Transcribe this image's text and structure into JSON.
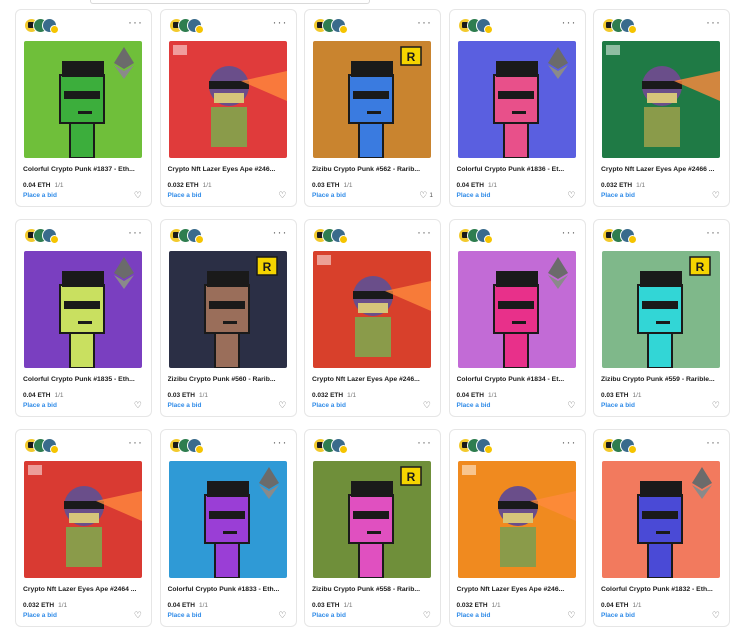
{
  "cards": [
    {
      "title": "Colorful Crypto Punk #1837 - Eth...",
      "price": "0.04 ETH",
      "edition": "1/1",
      "bid_label": "Place a bid",
      "likes": "",
      "art": "punk-green-afro",
      "bg": "#6fbf3a"
    },
    {
      "title": "Crypto Nft Lazer Eyes Ape #246...",
      "price": "0.032 ETH",
      "edition": "1/1",
      "bid_label": "Place a bid",
      "likes": "",
      "art": "ape-pizza",
      "bg": "#e03b3b"
    },
    {
      "title": "Zizibu Crypto Punk #562 - Rarib...",
      "price": "0.03 ETH",
      "edition": "1/1",
      "bid_label": "Place a bid",
      "likes": "1",
      "art": "punk-blue-beanie",
      "bg": "#c9842f"
    },
    {
      "title": "Colorful Crypto Punk #1836 - Et...",
      "price": "0.04 ETH",
      "edition": "1/1",
      "bid_label": "Place a bid",
      "likes": "",
      "art": "punk-pink-hair",
      "bg": "#5a5fe0"
    },
    {
      "title": "Crypto Nft Lazer Eyes Ape #2466 ...",
      "price": "0.032 ETH",
      "edition": "1/1",
      "bid_label": "Place a bid",
      "likes": "",
      "art": "ape-starbucks",
      "bg": "#1f7a45"
    },
    {
      "title": "Colorful Crypto Punk #1835 - Eth...",
      "price": "0.04 ETH",
      "edition": "1/1",
      "bid_label": "Place a bid",
      "likes": "",
      "art": "punk-lime-hat",
      "bg": "#7a3fc0"
    },
    {
      "title": "Zizibu Crypto Punk #560 - Rarib...",
      "price": "0.03 ETH",
      "edition": "1/1",
      "bid_label": "Place a bid",
      "likes": "",
      "art": "punk-brown",
      "bg": "#2b2f45"
    },
    {
      "title": "Crypto Nft Lazer Eyes Ape #246...",
      "price": "0.032 ETH",
      "edition": "1/1",
      "bid_label": "Place a bid",
      "likes": "",
      "art": "ape-mcdonalds",
      "bg": "#d8402b"
    },
    {
      "title": "Colorful Crypto Punk #1834 - Et...",
      "price": "0.04 ETH",
      "edition": "1/1",
      "bid_label": "Place a bid",
      "likes": "",
      "art": "punk-pink-green",
      "bg": "#c26bd6"
    },
    {
      "title": "Zizibu Crypto Punk #559 - Rarible...",
      "price": "0.03 ETH",
      "edition": "1/1",
      "bid_label": "Place a bid",
      "likes": "",
      "art": "punk-cyan",
      "bg": "#7fb88a"
    },
    {
      "title": "Crypto Nft Lazer Eyes Ape #2464 ...",
      "price": "0.032 ETH",
      "edition": "1/1",
      "bid_label": "Place a bid",
      "likes": "",
      "art": "ape-cocacola",
      "bg": "#d93a32"
    },
    {
      "title": "Colorful Crypto Punk #1833 - Eth...",
      "price": "0.04 ETH",
      "edition": "1/1",
      "bid_label": "Place a bid",
      "likes": "",
      "art": "punk-purple-tophat",
      "bg": "#2f9ad6"
    },
    {
      "title": "Zizibu Crypto Punk #558 - Rarib...",
      "price": "0.03 ETH",
      "edition": "1/1",
      "bid_label": "Place a bid",
      "likes": "",
      "art": "punk-pink-greenhat",
      "bg": "#6f8f3a"
    },
    {
      "title": "Crypto Nft Lazer Eyes Ape #246...",
      "price": "0.032 ETH",
      "edition": "1/1",
      "bid_label": "Place a bid",
      "likes": "",
      "art": "ape-burgerking",
      "bg": "#f08a1f"
    },
    {
      "title": "Colorful Crypto Punk #1832 - Eth...",
      "price": "0.04 ETH",
      "edition": "1/1",
      "bid_label": "Place a bid",
      "likes": "",
      "art": "punk-blue-cigarette",
      "bg": "#f27a5e"
    }
  ],
  "menu_glyph": "···",
  "heart_glyph": "♡"
}
